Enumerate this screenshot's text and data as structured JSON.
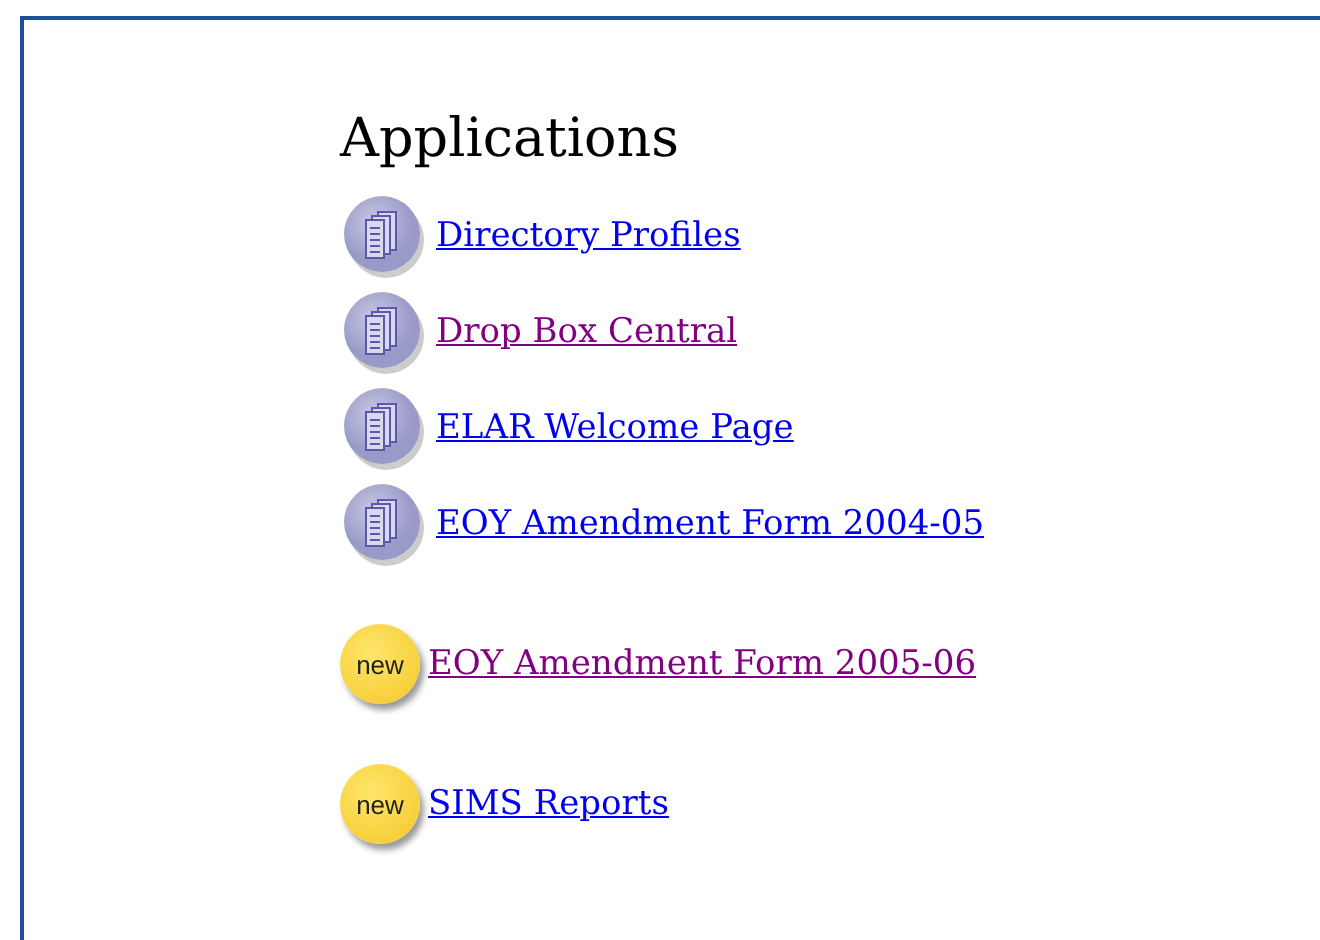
{
  "heading": "Applications",
  "items": [
    {
      "kind": "doc",
      "label": "Directory Profiles",
      "visited": false
    },
    {
      "kind": "doc",
      "label": "Drop Box Central",
      "visited": true
    },
    {
      "kind": "doc",
      "label": "ELAR Welcome Page",
      "visited": false
    },
    {
      "kind": "doc",
      "label": "EOY Amendment Form 2004-05",
      "visited": false
    },
    {
      "kind": "new",
      "badge": "new",
      "label": "EOY Amendment Form 2005-06",
      "visited": true
    },
    {
      "kind": "new",
      "badge": "new",
      "label": "SIMS Reports",
      "visited": false
    }
  ]
}
